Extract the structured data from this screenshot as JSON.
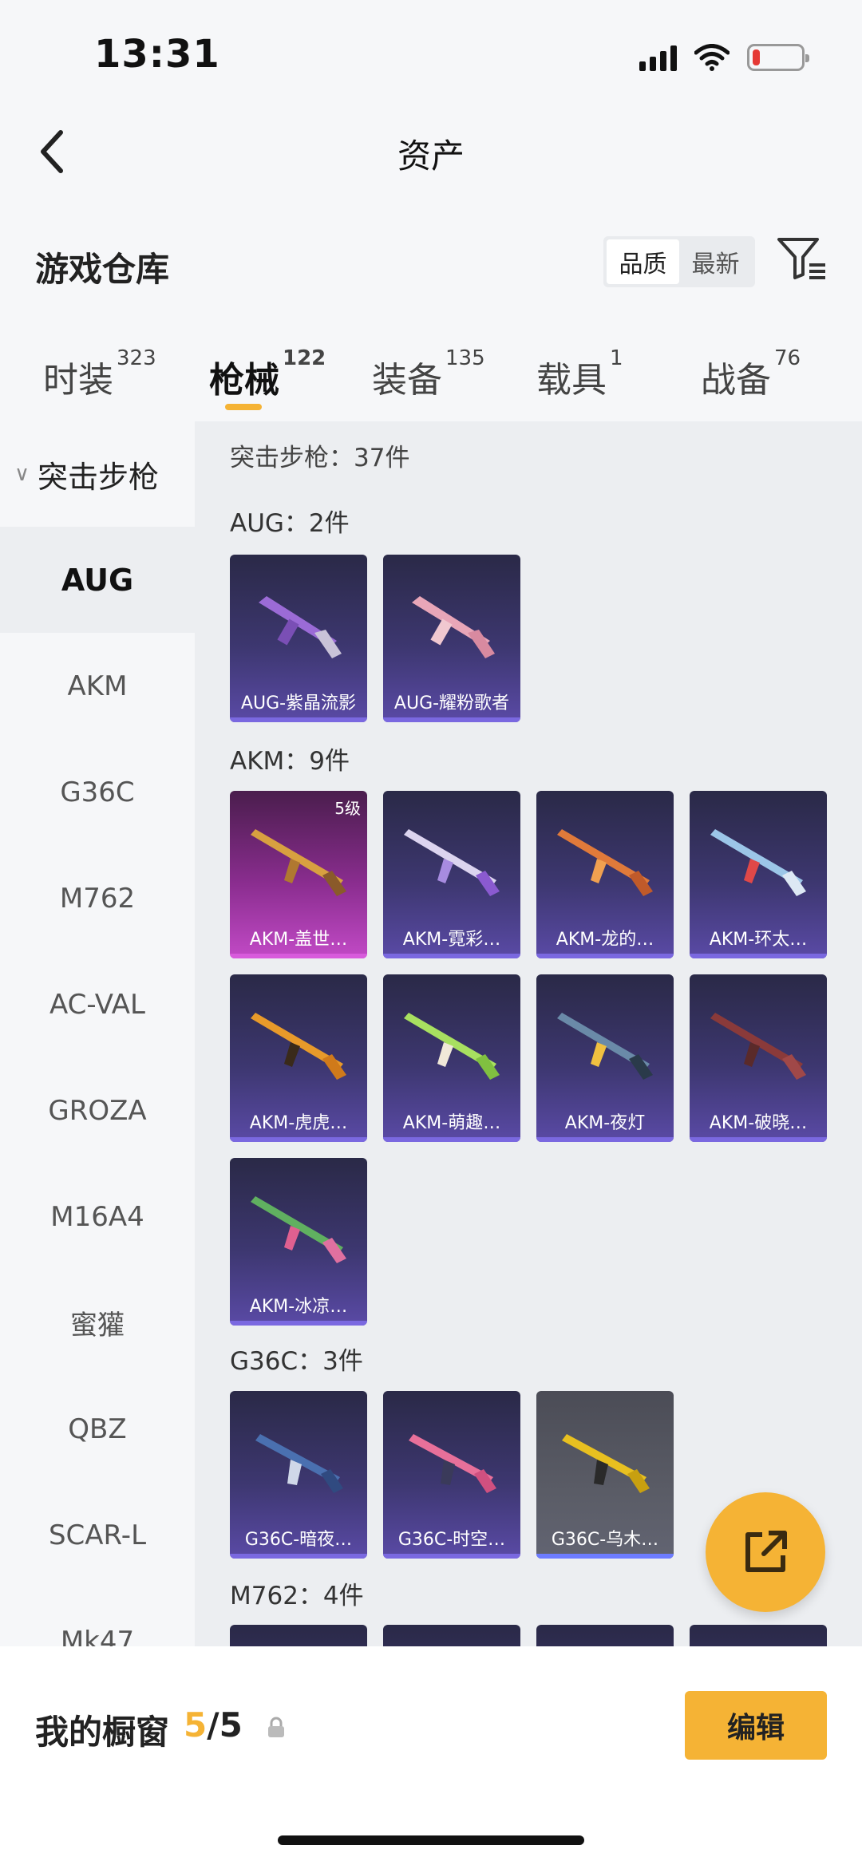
{
  "status": {
    "time": "13:31",
    "battery_level": 0.15
  },
  "nav": {
    "title": "资产",
    "back_icon": "chevron-left-icon"
  },
  "section": {
    "title": "游戏仓库",
    "sort_options": [
      "品质",
      "最新"
    ],
    "active_sort": "品质",
    "filter_icon": "filter-icon"
  },
  "tabs": [
    {
      "label": "时装",
      "count": "323"
    },
    {
      "label": "枪械",
      "count": "122"
    },
    {
      "label": "装备",
      "count": "135"
    },
    {
      "label": "载具",
      "count": "1"
    },
    {
      "label": "战备",
      "count": "76"
    }
  ],
  "sidebar": {
    "group": "突击步枪",
    "items": [
      "AUG",
      "AKM",
      "G36C",
      "M762",
      "AC-VAL",
      "GROZA",
      "M16A4",
      "蜜獾",
      "QBZ",
      "SCAR-L",
      "Mk47"
    ]
  },
  "content": {
    "category_count": "突击步枪：37件",
    "groups": [
      {
        "label": "AUG：2件",
        "items": [
          {
            "name": "AUG-紫晶流影"
          },
          {
            "name": "AUG-耀粉歌者"
          }
        ]
      },
      {
        "label": "AKM：9件",
        "items": [
          {
            "name": "AKM-盖世…",
            "level": "5级"
          },
          {
            "name": "AKM-霓彩…"
          },
          {
            "name": "AKM-龙的…"
          },
          {
            "name": "AKM-环太…"
          },
          {
            "name": "AKM-虎虎…"
          },
          {
            "name": "AKM-萌趣…"
          },
          {
            "name": "AKM-夜灯"
          },
          {
            "name": "AKM-破晓…"
          },
          {
            "name": "AKM-冰凉…"
          }
        ]
      },
      {
        "label": "G36C：3件",
        "items": [
          {
            "name": "G36C-暗夜…"
          },
          {
            "name": "G36C-时空…"
          },
          {
            "name": "G36C-乌木…"
          }
        ]
      },
      {
        "label": "M762：4件",
        "items": []
      }
    ]
  },
  "fab": {
    "icon": "share-export-icon"
  },
  "bottom": {
    "showcase_label": "我的橱窗",
    "showcase_current": "5",
    "showcase_total": "/5",
    "edit_label": "编辑",
    "lock_icon": "lock-icon"
  },
  "colors": {
    "accent": "#f5b335",
    "card_purple": "#3d3770",
    "card_pink": "#8a2d8f",
    "card_grey": "#5a5c66"
  }
}
